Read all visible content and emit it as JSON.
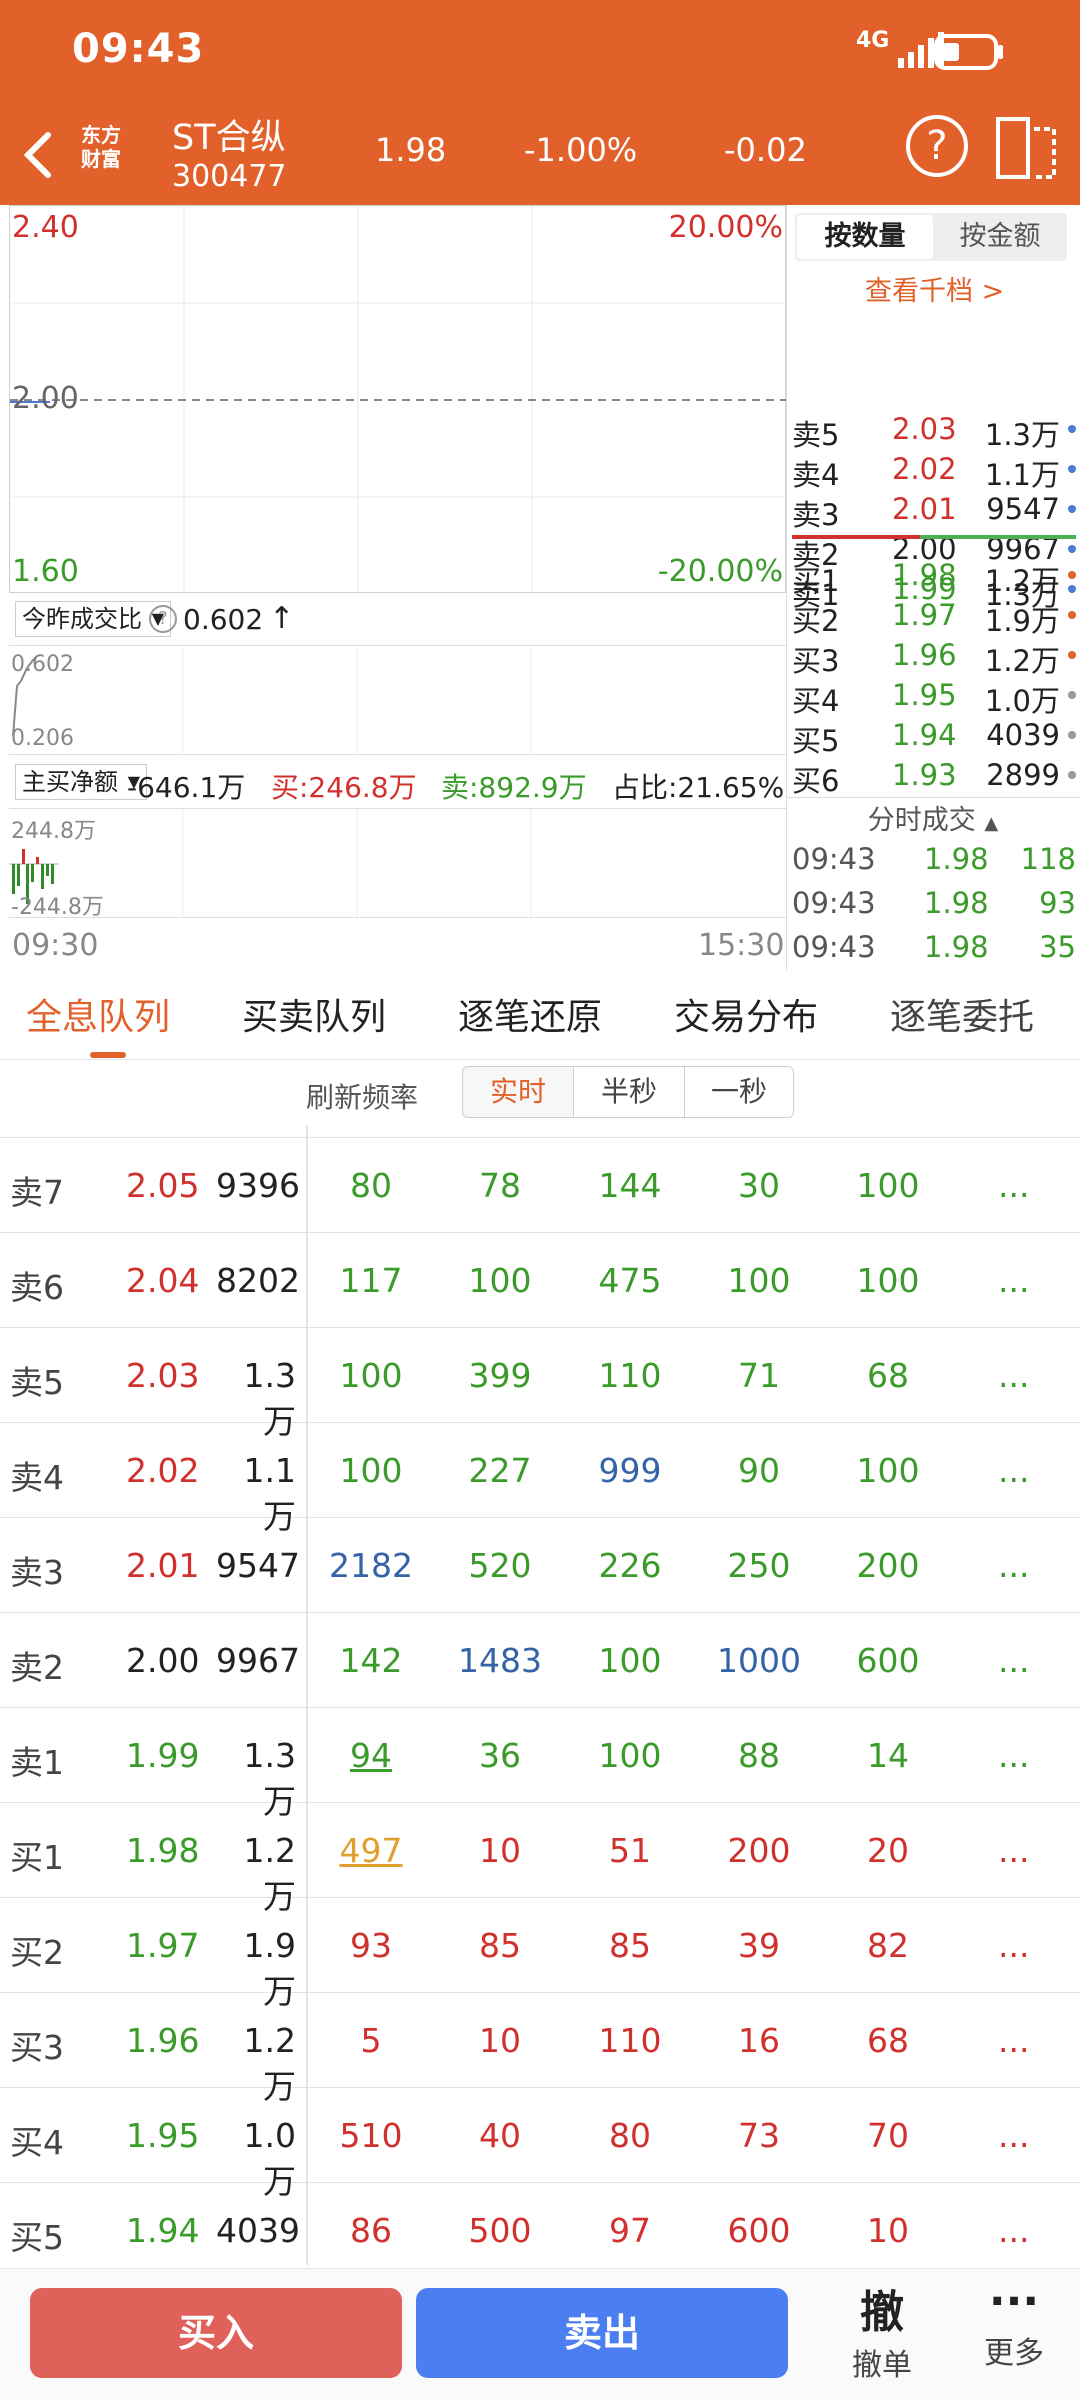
{
  "status": {
    "time": "09:43",
    "network": "4G"
  },
  "header": {
    "back": "<",
    "logo_line1": "东方",
    "logo_line2": "财富",
    "stock_name": "ST合纵",
    "stock_code": "300477",
    "price": "1.98",
    "change_pct": "-1.00%",
    "change": "-0.02"
  },
  "chart": {
    "price_top": "2.40",
    "pct_top": "20.00%",
    "price_mid": "2.00",
    "price_bottom": "1.60",
    "pct_bottom": "-20.00%",
    "time_start": "09:30",
    "time_end": "15:30"
  },
  "indicator1": {
    "selector": "今昨成交比",
    "value": "0.602",
    "arrow": "↑",
    "axis_top": "0.602",
    "axis_bottom": "0.206"
  },
  "indicator2": {
    "selector": "主买净额",
    "net": "-646.1万",
    "buy": "买:246.8万",
    "sell": "卖:892.9万",
    "ratio": "占比:21.65%",
    "axis_top": "244.8万",
    "axis_bottom": "-244.8万"
  },
  "orderbook": {
    "tab_qty": "按数量",
    "tab_amt": "按金额",
    "view_more": "查看千档 >",
    "asks": [
      {
        "label": "卖5",
        "price": "2.03",
        "vol": "1.3万"
      },
      {
        "label": "卖4",
        "price": "2.02",
        "vol": "1.1万"
      },
      {
        "label": "卖3",
        "price": "2.01",
        "vol": "9547"
      },
      {
        "label": "卖2",
        "price": "2.00",
        "vol": "9967"
      },
      {
        "label": "卖1",
        "price": "1.99",
        "vol": "1.3万"
      }
    ],
    "bids": [
      {
        "label": "买1",
        "price": "1.98",
        "vol": "1.2万"
      },
      {
        "label": "买2",
        "price": "1.97",
        "vol": "1.9万"
      },
      {
        "label": "买3",
        "price": "1.96",
        "vol": "1.2万"
      },
      {
        "label": "买4",
        "price": "1.95",
        "vol": "1.0万"
      },
      {
        "label": "买5",
        "price": "1.94",
        "vol": "4039"
      },
      {
        "label": "买6",
        "price": "1.93",
        "vol": "2899"
      }
    ],
    "trades_title": "分时成交",
    "trades": [
      {
        "time": "09:43",
        "price": "1.98",
        "vol": "118"
      },
      {
        "time": "09:43",
        "price": "1.98",
        "vol": "93"
      },
      {
        "time": "09:43",
        "price": "1.98",
        "vol": "35"
      }
    ]
  },
  "tabs": [
    "全息队列",
    "买卖队列",
    "逐笔还原",
    "交易分布",
    "逐笔委托"
  ],
  "freq": {
    "label": "刷新频率",
    "options": [
      "实时",
      "半秒",
      "一秒"
    ]
  },
  "queue": [
    {
      "label": "卖7",
      "price": "2.05",
      "vol": "9396",
      "orders": [
        "80",
        "78",
        "144",
        "30",
        "100"
      ]
    },
    {
      "label": "卖6",
      "price": "2.04",
      "vol": "8202",
      "orders": [
        "117",
        "100",
        "475",
        "100",
        "100"
      ]
    },
    {
      "label": "卖5",
      "price": "2.03",
      "vol": "1.3万",
      "orders": [
        "100",
        "399",
        "110",
        "71",
        "68"
      ]
    },
    {
      "label": "卖4",
      "price": "2.02",
      "vol": "1.1万",
      "orders": [
        "100",
        "227",
        "999",
        "90",
        "100"
      ]
    },
    {
      "label": "卖3",
      "price": "2.01",
      "vol": "9547",
      "orders": [
        "2182",
        "520",
        "226",
        "250",
        "200"
      ]
    },
    {
      "label": "卖2",
      "price": "2.00",
      "vol": "9967",
      "orders": [
        "142",
        "1483",
        "100",
        "1000",
        "600"
      ]
    },
    {
      "label": "卖1",
      "price": "1.99",
      "vol": "1.3万",
      "orders": [
        "94",
        "36",
        "100",
        "88",
        "14"
      ]
    },
    {
      "label": "买1",
      "price": "1.98",
      "vol": "1.2万",
      "orders": [
        "497",
        "10",
        "51",
        "200",
        "20"
      ]
    },
    {
      "label": "买2",
      "price": "1.97",
      "vol": "1.9万",
      "orders": [
        "93",
        "85",
        "85",
        "39",
        "82"
      ]
    },
    {
      "label": "买3",
      "price": "1.96",
      "vol": "1.2万",
      "orders": [
        "5",
        "10",
        "110",
        "16",
        "68"
      ]
    },
    {
      "label": "买4",
      "price": "1.95",
      "vol": "1.0万",
      "orders": [
        "510",
        "40",
        "80",
        "73",
        "70"
      ]
    },
    {
      "label": "买5",
      "price": "1.94",
      "vol": "4039",
      "orders": [
        "86",
        "500",
        "97",
        "600",
        "10"
      ]
    }
  ],
  "more": "...",
  "bottom": {
    "buy": "买入",
    "sell": "卖出",
    "cancel_icon": "撤",
    "cancel": "撤单",
    "more_icon": "···",
    "more": "更多"
  }
}
